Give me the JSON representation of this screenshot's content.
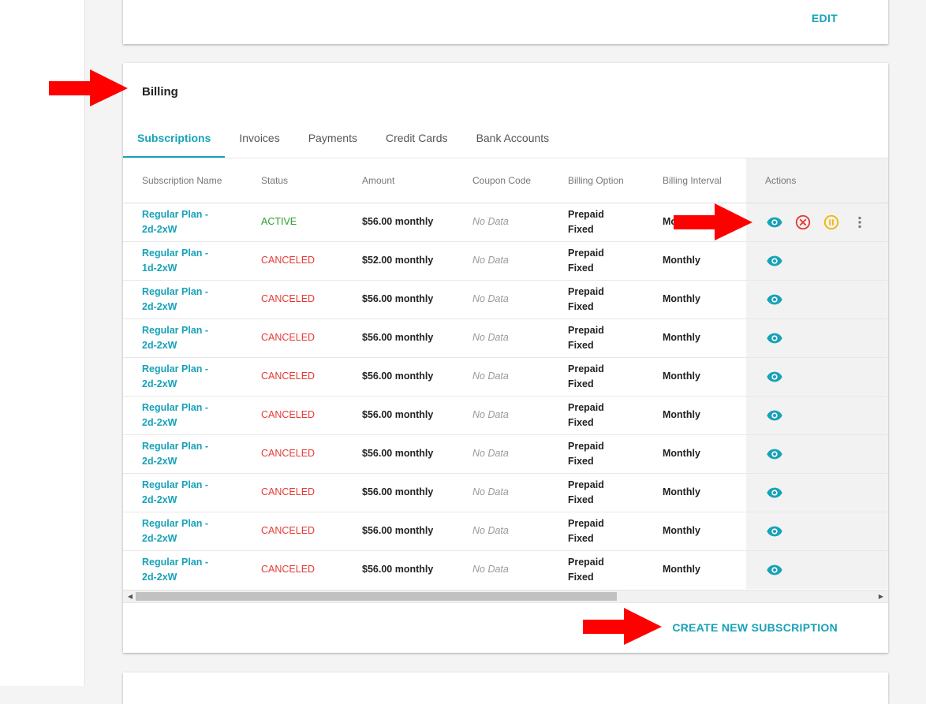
{
  "top_card": {
    "edit_label": "EDIT"
  },
  "billing": {
    "title": "Billing",
    "tabs": [
      {
        "label": "Subscriptions",
        "active": true
      },
      {
        "label": "Invoices",
        "active": false
      },
      {
        "label": "Payments",
        "active": false
      },
      {
        "label": "Credit Cards",
        "active": false
      },
      {
        "label": "Bank Accounts",
        "active": false
      }
    ],
    "table": {
      "headers": {
        "name": "Subscription Name",
        "status": "Status",
        "amount": "Amount",
        "coupon": "Coupon Code",
        "option": "Billing Option",
        "interval": "Billing Interval",
        "actions": "Actions"
      },
      "rows": [
        {
          "name": "Regular Plan - 2d-2xW",
          "status": "ACTIVE",
          "amount": "$56.00 monthly",
          "coupon": "No Data",
          "option": "Prepaid Fixed",
          "interval": "Monthly"
        },
        {
          "name": "Regular Plan - 1d-2xW",
          "status": "CANCELED",
          "amount": "$52.00 monthly",
          "coupon": "No Data",
          "option": "Prepaid Fixed",
          "interval": "Monthly"
        },
        {
          "name": "Regular Plan - 2d-2xW",
          "status": "CANCELED",
          "amount": "$56.00 monthly",
          "coupon": "No Data",
          "option": "Prepaid Fixed",
          "interval": "Monthly"
        },
        {
          "name": "Regular Plan - 2d-2xW",
          "status": "CANCELED",
          "amount": "$56.00 monthly",
          "coupon": "No Data",
          "option": "Prepaid Fixed",
          "interval": "Monthly"
        },
        {
          "name": "Regular Plan - 2d-2xW",
          "status": "CANCELED",
          "amount": "$56.00 monthly",
          "coupon": "No Data",
          "option": "Prepaid Fixed",
          "interval": "Monthly"
        },
        {
          "name": "Regular Plan - 2d-2xW",
          "status": "CANCELED",
          "amount": "$56.00 monthly",
          "coupon": "No Data",
          "option": "Prepaid Fixed",
          "interval": "Monthly"
        },
        {
          "name": "Regular Plan - 2d-2xW",
          "status": "CANCELED",
          "amount": "$56.00 monthly",
          "coupon": "No Data",
          "option": "Prepaid Fixed",
          "interval": "Monthly"
        },
        {
          "name": "Regular Plan - 2d-2xW",
          "status": "CANCELED",
          "amount": "$56.00 monthly",
          "coupon": "No Data",
          "option": "Prepaid Fixed",
          "interval": "Monthly"
        },
        {
          "name": "Regular Plan - 2d-2xW",
          "status": "CANCELED",
          "amount": "$56.00 monthly",
          "coupon": "No Data",
          "option": "Prepaid Fixed",
          "interval": "Monthly"
        },
        {
          "name": "Regular Plan - 2d-2xW",
          "status": "CANCELED",
          "amount": "$56.00 monthly",
          "coupon": "No Data",
          "option": "Prepaid Fixed",
          "interval": "Monthly"
        }
      ]
    },
    "create_label": "CREATE NEW SUBSCRIPTION"
  },
  "colors": {
    "accent": "#17a2b8",
    "active": "#2a9d2a",
    "canceled": "#e53935",
    "cancel_icon": "#e53935",
    "pause_icon": "#f5b400",
    "annotation_arrow": "#ff0000"
  },
  "icons": {
    "view": "eye-icon",
    "cancel": "cancel-circle-icon",
    "pause": "pause-circle-icon",
    "more": "more-vertical-icon",
    "annotation": "red-arrow-annotation"
  }
}
